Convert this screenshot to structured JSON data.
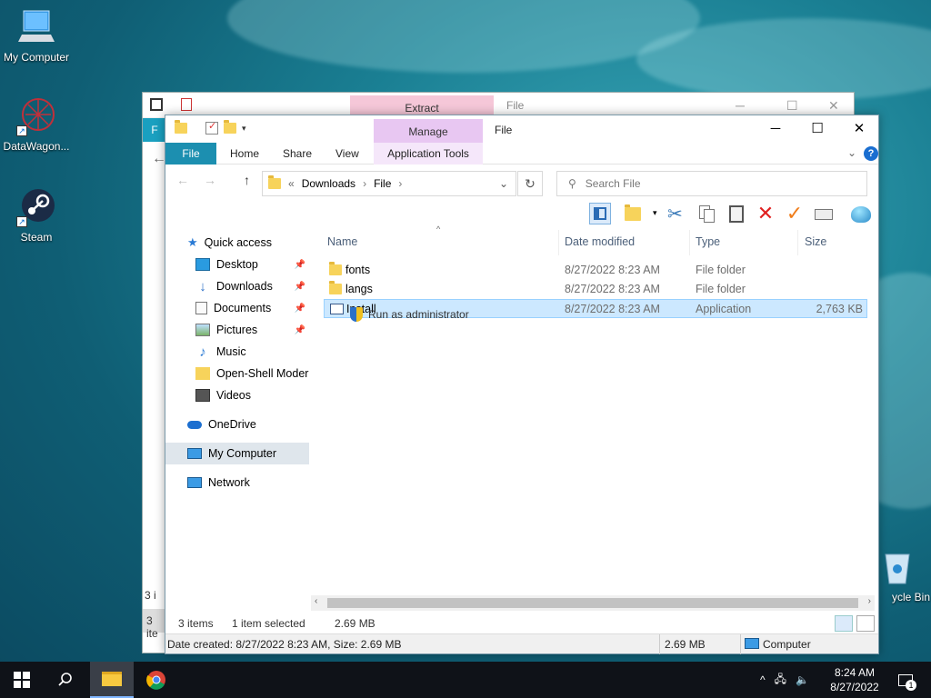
{
  "desktop": {
    "icons": [
      {
        "label": "My Computer"
      },
      {
        "label": "DataWagon..."
      },
      {
        "label": "Steam"
      },
      {
        "label": "ycle Bin"
      }
    ]
  },
  "back_window": {
    "extract_tab": "Extract",
    "title": "File",
    "ribbon_letter": "F",
    "status_partial": "3 i",
    "status_partial2": "3 ite"
  },
  "window": {
    "manage_tab": "Manage",
    "title": "File",
    "ribbon_tabs": [
      "File",
      "Home",
      "Share",
      "View",
      "Application Tools"
    ],
    "help": "?",
    "breadcrumb": {
      "prefix": "«",
      "parts": [
        "Downloads",
        "File"
      ]
    },
    "search_placeholder": "Search File"
  },
  "nav": {
    "quick_access": "Quick access",
    "items": [
      {
        "label": "Desktop",
        "pinned": true
      },
      {
        "label": "Downloads",
        "pinned": true
      },
      {
        "label": "Documents",
        "pinned": true
      },
      {
        "label": "Pictures",
        "pinned": true
      },
      {
        "label": "Music",
        "pinned": false
      },
      {
        "label": "Open-Shell Modern",
        "pinned": false
      },
      {
        "label": "Videos",
        "pinned": false
      }
    ],
    "onedrive": "OneDrive",
    "my_computer": "My Computer",
    "network": "Network"
  },
  "list": {
    "columns": [
      "Name",
      "Date modified",
      "Type",
      "Size"
    ],
    "rows": [
      {
        "name": "fonts",
        "date": "8/27/2022 8:23 AM",
        "type": "File folder",
        "size": ""
      },
      {
        "name": "langs",
        "date": "8/27/2022 8:23 AM",
        "type": "File folder",
        "size": ""
      },
      {
        "name": "Install",
        "date": "8/27/2022 8:23 AM",
        "type": "Application",
        "size": "2,763 KB"
      }
    ],
    "tooltip": "Run as administrator"
  },
  "status": {
    "count": "3 items",
    "selected": "1 item selected",
    "size": "2.69 MB"
  },
  "details_bar": {
    "info": "Date created: 8/27/2022 8:23 AM, Size: 2.69 MB",
    "size": "2.69 MB",
    "location": "Computer"
  },
  "taskbar": {
    "time": "8:24 AM",
    "date": "8/27/2022",
    "notification_count": "1"
  },
  "colors": {
    "file_tab": "#1c8fb0",
    "manage_tab": "#e8c7f2",
    "selection": "#cce8ff"
  }
}
